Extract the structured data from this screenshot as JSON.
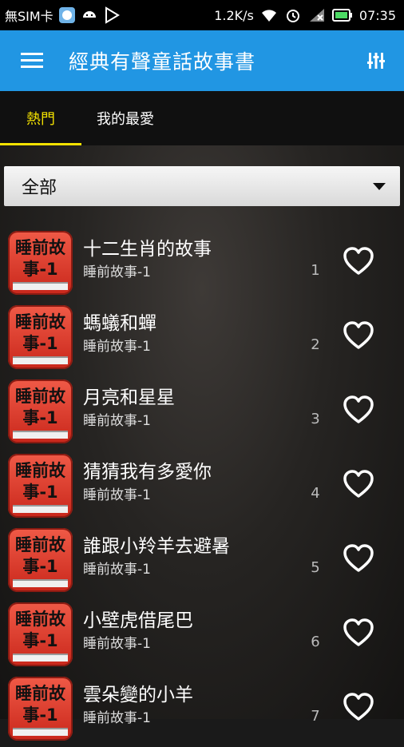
{
  "status_bar": {
    "carrier": "無SIM卡",
    "speed": "1.2K/s",
    "time": "07:35"
  },
  "app_bar": {
    "title": "經典有聲童話故事書"
  },
  "tabs": [
    "熱門",
    "我的最愛"
  ],
  "filter": {
    "selected": "全部"
  },
  "book_icon": {
    "line1": "睡前故",
    "line2": "事-1"
  },
  "stories": [
    {
      "title": "十二生肖的故事",
      "category": "睡前故事-1",
      "number": "1"
    },
    {
      "title": "螞蟻和蟬",
      "category": "睡前故事-1",
      "number": "2"
    },
    {
      "title": "月亮和星星",
      "category": "睡前故事-1",
      "number": "3"
    },
    {
      "title": "猜猜我有多愛你",
      "category": "睡前故事-1",
      "number": "4"
    },
    {
      "title": "誰跟小羚羊去避暑",
      "category": "睡前故事-1",
      "number": "5"
    },
    {
      "title": "小壁虎借尾巴",
      "category": "睡前故事-1",
      "number": "6"
    },
    {
      "title": "雲朵變的小羊",
      "category": "睡前故事-1",
      "number": "7"
    }
  ],
  "colors": {
    "app_bar": "#2196e3",
    "active_tab": "#f4e200",
    "book_red": "#e0402f"
  }
}
